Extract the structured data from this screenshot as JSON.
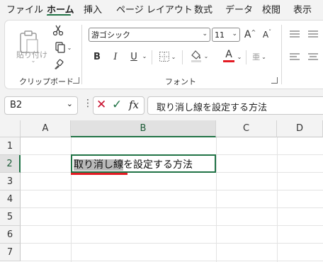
{
  "menu": {
    "tabs": [
      "ファイル",
      "ホーム",
      "挿入",
      "ページ レイアウト",
      "数式",
      "データ",
      "校閲",
      "表示"
    ],
    "active_tab": "ホーム"
  },
  "ribbon": {
    "clipboard": {
      "paste_label": "貼り付け",
      "group_label": "クリップボード"
    },
    "font": {
      "font_name": "游ゴシック",
      "font_size": "11",
      "bold": "B",
      "italic": "I",
      "underline": "U",
      "font_color_letter": "A",
      "grow_font": "A",
      "shrink_font": "A",
      "phonetic": "亜",
      "group_label": "フォント"
    },
    "colors": {
      "font_color_bar": "#e31b23",
      "accent": "#217346"
    }
  },
  "formula_bar": {
    "name_box": "B2",
    "fx": "fx",
    "formula": "取り消し線を設定する方法"
  },
  "grid": {
    "columns": [
      "A",
      "B",
      "C",
      "D"
    ],
    "rows": [
      "1",
      "2",
      "3",
      "4",
      "5",
      "6",
      "7"
    ],
    "selected_column": "B",
    "selected_row": "2",
    "active_cell": {
      "ref": "B2",
      "selected_text": "取り消し線",
      "remaining_text": "を設定する方法"
    }
  }
}
